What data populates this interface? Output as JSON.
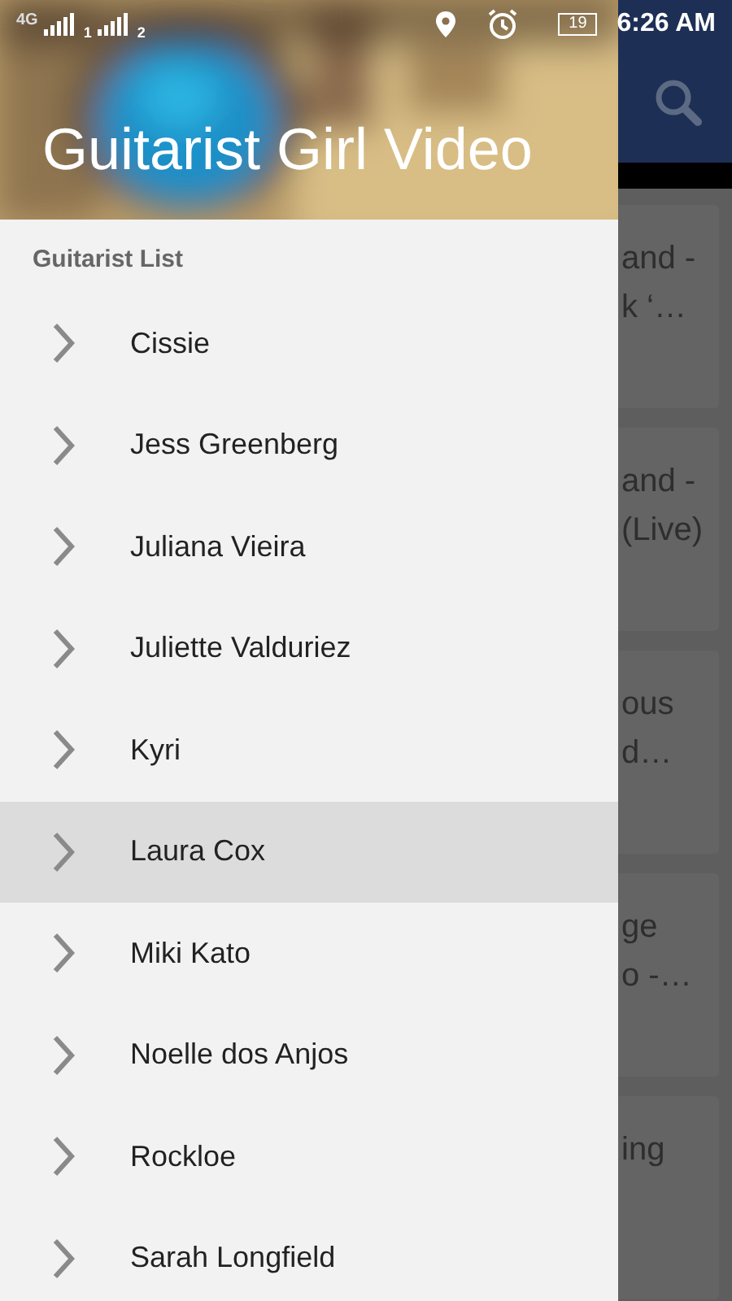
{
  "status_bar": {
    "network": "4G",
    "sim_1": "1",
    "sim_2": "2",
    "battery": "19",
    "time": "6:26 AM"
  },
  "drawer": {
    "title": "Guitarist Girl Video",
    "section": "Guitarist List",
    "items": [
      {
        "label": "Cissie",
        "selected": false
      },
      {
        "label": "Jess Greenberg",
        "selected": false
      },
      {
        "label": "Juliana Vieira",
        "selected": false
      },
      {
        "label": "Juliette Valduriez",
        "selected": false
      },
      {
        "label": "Kyri",
        "selected": false
      },
      {
        "label": "Laura Cox",
        "selected": true
      },
      {
        "label": "Miki Kato",
        "selected": false
      },
      {
        "label": "Noelle dos Anjos",
        "selected": false
      },
      {
        "label": "Rockloe",
        "selected": false
      },
      {
        "label": "Sarah Longfield",
        "selected": false
      }
    ]
  },
  "background": {
    "cards": [
      {
        "lines": [
          "and -",
          "k ‘…"
        ]
      },
      {
        "lines": [
          "and -",
          "(Live)"
        ]
      },
      {
        "lines": [
          "ous",
          "d…"
        ]
      },
      {
        "lines": [
          "ge",
          "o -…"
        ]
      },
      {
        "lines": [
          "ing"
        ]
      }
    ]
  }
}
